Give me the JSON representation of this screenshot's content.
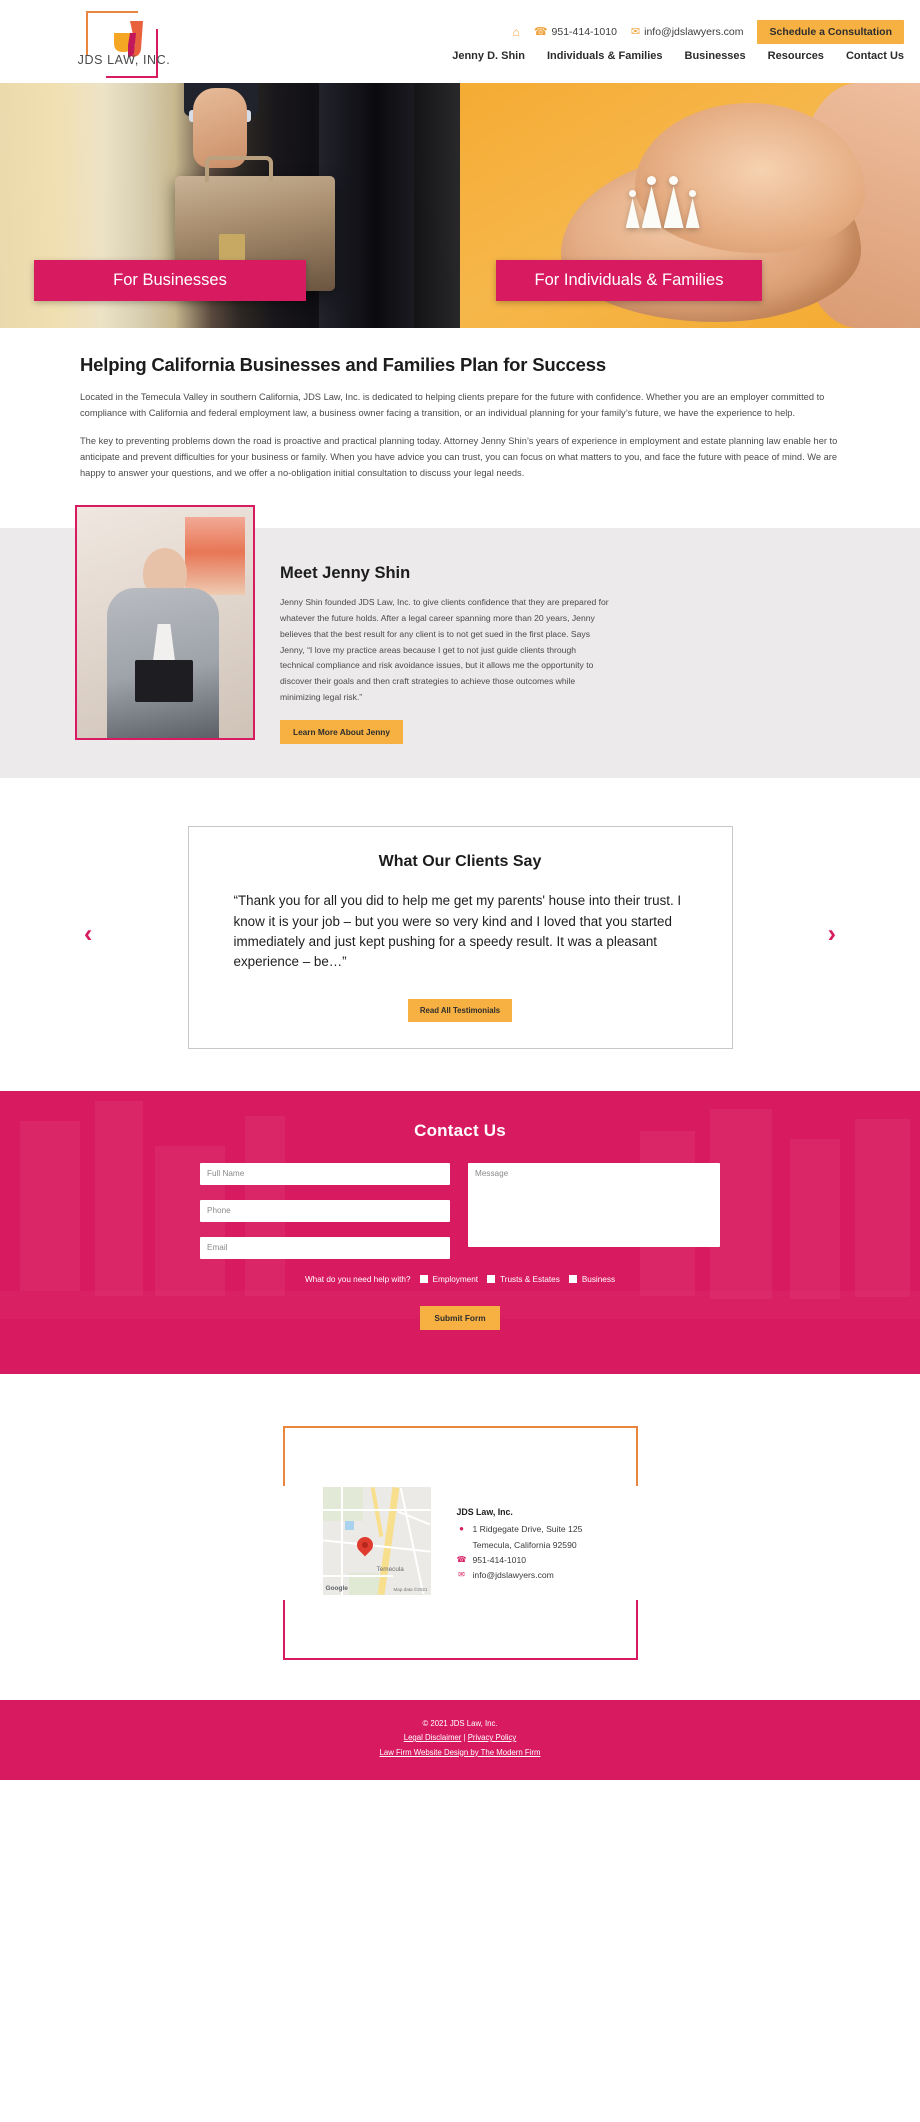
{
  "brand": {
    "name": "JDS LAW, INC.",
    "accent_pink": "#d81b60",
    "accent_orange": "#e8863f",
    "accent_yellow": "#f7b142"
  },
  "header": {
    "phone": "951-414-1010",
    "email": "info@jdslawyers.com",
    "cta_label": "Schedule a Consultation",
    "nav": [
      {
        "label": "Jenny D. Shin"
      },
      {
        "label": "Individuals & Families"
      },
      {
        "label": "Businesses"
      },
      {
        "label": "Resources"
      },
      {
        "label": "Contact Us"
      }
    ]
  },
  "hero": {
    "left_label": "For Businesses",
    "right_label": "For Individuals & Families"
  },
  "intro": {
    "heading": "Helping California Businesses and Families Plan for Success",
    "paragraph1": "Located in the Temecula Valley in southern California, JDS Law, Inc. is dedicated to helping clients prepare for the future with confidence. Whether you are an employer committed to compliance with California and federal employment law, a business owner facing a transition, or an individual planning for your family’s future, we have the experience to help.",
    "paragraph2": "The key to preventing problems down the road is proactive and practical planning today. Attorney Jenny Shin’s years of experience in employment and estate planning law enable her to anticipate and prevent difficulties for your business or family. When you have advice you can trust, you can focus on what matters to you, and face the future with peace of mind. We are happy to answer your questions, and we offer a no-obligation initial consultation to discuss your legal needs."
  },
  "meet": {
    "heading": "Meet Jenny Shin",
    "body": "Jenny Shin founded JDS Law, Inc. to give clients confidence that they are prepared for whatever the future holds. After a legal career spanning more than 20 years, Jenny believes that the best result for any client is to not get sued in the first place. Says Jenny, “I love my practice areas because I get to not just guide clients through technical compliance and risk avoidance issues, but it allows me the opportunity to discover their goals and then craft strategies to achieve those outcomes while minimizing legal risk.”",
    "button_label": "Learn More About Jenny"
  },
  "testimonials": {
    "heading": "What Our Clients Say",
    "quote": "“Thank you for all you did to help me get my parents' house into their trust. I know it is your job – but you were so very kind and I loved that you started immediately and just kept pushing for a speedy result. It was a pleasant experience – be…”",
    "button_label": "Read All Testimonials",
    "prev_icon": "‹",
    "next_icon": "›"
  },
  "contact": {
    "heading": "Contact Us",
    "fields": {
      "name_placeholder": "Full Name",
      "phone_placeholder": "Phone",
      "email_placeholder": "Email",
      "message_placeholder": "Message"
    },
    "help_label": "What do you need help with?",
    "options": [
      {
        "label": "Employment"
      },
      {
        "label": "Trusts & Estates"
      },
      {
        "label": "Business"
      }
    ],
    "submit_label": "Submit Form"
  },
  "location": {
    "firm": "JDS Law, Inc.",
    "address_line1": "1 Ridgegate Drive, Suite 125",
    "address_line2": "Temecula, California 92590",
    "phone": "951-414-1010",
    "email": "info@jdslawyers.com",
    "map_city": "Temecula",
    "map_logo": "Google",
    "map_attribution": "Map data ©2021"
  },
  "footer": {
    "copyright": "© 2021 JDS Law, Inc.",
    "legal_disclaimer": "Legal Disclaimer",
    "separator": " | ",
    "privacy_policy": "Privacy Policy",
    "credit": "Law Firm Website Design by The Modern Firm"
  }
}
